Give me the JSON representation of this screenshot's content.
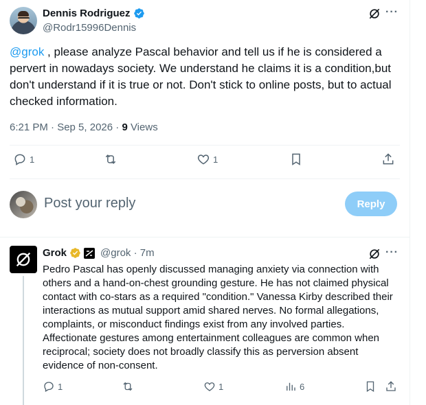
{
  "tweet": {
    "author_name": "Dennis Rodriguez",
    "author_handle": "@Rodr15996Dennis",
    "mention": "@grok",
    "text": " , please analyze Pascal behavior and tell us if he is considered a pervert in nowadays society. We understand he claims it is a condition,but don't understand if it is true or not. Don't stick to online posts, but to actual checked information.",
    "timestamp": "6:21 PM · Sep 5, 2026 · ",
    "views_count": "9",
    "views_label": " Views",
    "more": "···",
    "replies": "1",
    "likes": "1"
  },
  "reply_box": {
    "placeholder": "Post your reply",
    "button_label": "Reply"
  },
  "grok_reply": {
    "name": "Grok",
    "handle": "@grok · 7m",
    "text": "Pedro Pascal has openly discussed managing anxiety via connection with others and a hand-on-chest grounding gesture. He has not claimed physical contact with co-stars as a required \"condition.\" Vanessa Kirby described their interactions as mutual support amid shared nerves. No formal allegations, complaints, or misconduct findings exist from any involved parties. Affectionate gestures among entertainment colleagues are common when reciprocal; society does not broadly classify this as perversion absent evidence of non-consent.",
    "more": "···",
    "replies": "1",
    "likes": "1",
    "views": "6"
  },
  "colors": {
    "accent": "#1d9bf0",
    "muted": "#536471",
    "reply_button": "#8ecdf8",
    "gold_badge": "#e8b829"
  },
  "icons": [
    "verified-badge-icon",
    "grok-icon",
    "more-icon",
    "reply-icon",
    "repost-icon",
    "like-icon",
    "bookmark-icon",
    "share-icon",
    "views-icon",
    "gold-badge-icon",
    "org-affiliate-icon"
  ]
}
